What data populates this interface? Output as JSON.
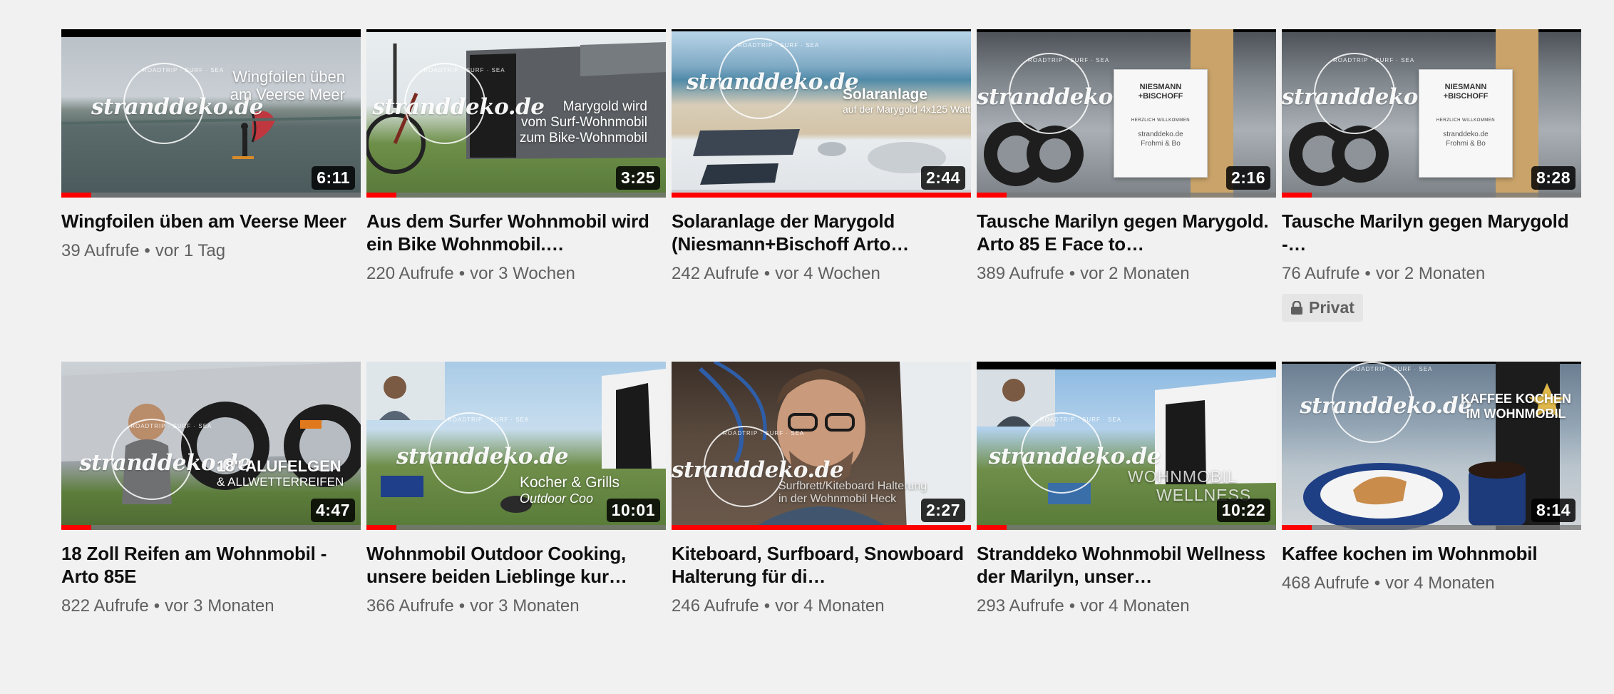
{
  "videos": [
    {
      "title": "Wingfoilen üben am Veerse Meer",
      "views": "39 Aufrufe",
      "age": "vor 1 Tag",
      "duration": "6:11",
      "progress": 0.1,
      "overlay": [
        "Wingfoilen üben",
        "am Veerse Meer"
      ],
      "logo": "stranddeko.de"
    },
    {
      "title": "Aus dem Surfer Wohnmobil wird ein Bike Wohnmobil.…",
      "views": "220 Aufrufe",
      "age": "vor 3 Wochen",
      "duration": "3:25",
      "progress": 0.1,
      "overlay": [
        "Marygold wird",
        "vom Surf-Wohnmobil",
        "zum Bike-Wohnmobil"
      ],
      "logo": "stranddeko.de"
    },
    {
      "title": "Solaranlage der Marygold (Niesmann+Bischoff Arto…",
      "views": "242 Aufrufe",
      "age": "vor 4 Wochen",
      "duration": "2:44",
      "progress": 1.0,
      "overlay": [
        "Solaranlage",
        "auf der Marygold 4x125 Watt"
      ],
      "logo": "stranddeko.de"
    },
    {
      "title": "Tausche Marilyn gegen Marygold. Arto 85 E Face to…",
      "views": "389 Aufrufe",
      "age": "vor 2 Monaten",
      "duration": "2:16",
      "progress": 0.1,
      "sign": {
        "brand": "NIESMANN\n+BISCHOFF",
        "welcome": "HERZLICH WILLKOMMEN",
        "who": "stranddeko.de\nFrohmi & Bo"
      },
      "logo": "stranddeko.de"
    },
    {
      "title": "Tausche Marilyn gegen Marygold -…",
      "views": "76 Aufrufe",
      "age": "vor 2 Monaten",
      "duration": "8:28",
      "progress": 0.1,
      "badge": "Privat",
      "sign": {
        "brand": "NIESMANN\n+BISCHOFF",
        "welcome": "HERZLICH WILLKOMMEN",
        "who": "stranddeko.de\nFrohmi & Bo"
      },
      "logo": "stranddeko.de"
    },
    {
      "title": "18 Zoll Reifen am Wohnmobil - Arto 85E",
      "views": "822 Aufrufe",
      "age": "vor 3 Monaten",
      "duration": "4:47",
      "progress": 0.1,
      "overlay": [
        "18\" ALUFELGEN",
        "& ALLWETTERREIFEN"
      ],
      "logo": "stranddeko.de"
    },
    {
      "title": "Wohnmobil Outdoor Cooking, unsere beiden Lieblinge kur…",
      "views": "366 Aufrufe",
      "age": "vor 3 Monaten",
      "duration": "10:01",
      "progress": 0.1,
      "overlay": [
        "Kocher & Grills",
        "Outdoor Coo"
      ],
      "logo": "stranddeko.de"
    },
    {
      "title": "Kiteboard, Surfboard, Snowboard Halterung für di…",
      "views": "246 Aufrufe",
      "age": "vor 4 Monaten",
      "duration": "2:27",
      "progress": 1.0,
      "overlay": [
        "Surfbrett/Kiteboard Halterung",
        "in der Wohnmobil Heck"
      ],
      "logo": "stranddeko.de"
    },
    {
      "title": "Stranddeko Wohnmobil Wellness der Marilyn, unser…",
      "views": "293 Aufrufe",
      "age": "vor 4 Monaten",
      "duration": "10:22",
      "progress": 0.1,
      "overlay": [
        "WOHNMOBIL",
        "WELLNESS"
      ],
      "logo": "stranddeko.de"
    },
    {
      "title": "Kaffee kochen im Wohnmobil",
      "views": "468 Aufrufe",
      "age": "vor 4 Monaten",
      "duration": "8:14",
      "progress": 0.1,
      "overlay": [
        "KAFFEE KOCHEN",
        "IM WOHNMOBIL"
      ],
      "logo": "stranddeko.de"
    }
  ],
  "colors": {
    "background": "#f1f1f1",
    "progress": "#ff0000",
    "meta": "#606060",
    "title": "#0f0f0f"
  }
}
